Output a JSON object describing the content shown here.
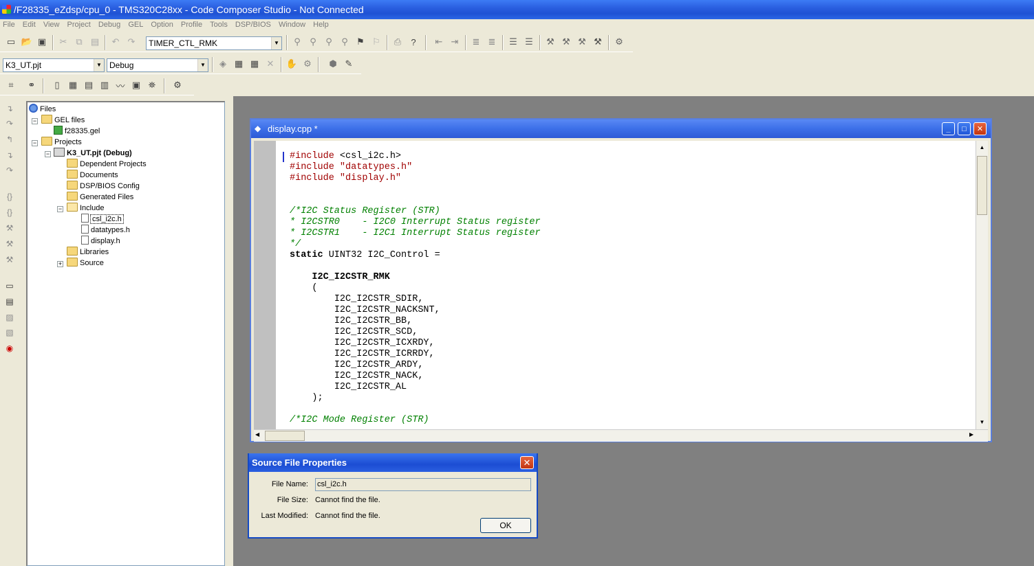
{
  "window": {
    "title": "/F28335_eZdsp/cpu_0 - TMS320C28xx - Code Composer Studio - Not Connected"
  },
  "menu": [
    "File",
    "Edit",
    "View",
    "Project",
    "Debug",
    "GEL",
    "Option",
    "Profile",
    "Tools",
    "DSP/BIOS",
    "Window",
    "Help"
  ],
  "toolbar": {
    "symbol_combo": "TIMER_CTL_RMK",
    "project_combo": "K3_UT.pjt",
    "config_combo": "Debug"
  },
  "tree": {
    "root": "Files",
    "gel_files": "GEL files",
    "gel_file": "f28335.gel",
    "projects": "Projects",
    "project": "K3_UT.pjt (Debug)",
    "dependent": "Dependent Projects",
    "documents": "Documents",
    "dspbios": "DSP/BIOS Config",
    "generated": "Generated Files",
    "include": "Include",
    "inc_file_1": "csl_i2c.h",
    "inc_file_2": "datatypes.h",
    "inc_file_3": "display.h",
    "libraries": "Libraries",
    "source": "Source",
    "collapse_sign": "−",
    "expand_sign": "+"
  },
  "editor": {
    "title": "display.cpp *",
    "lines": {
      "l1a": "#include ",
      "l1b": "<csl_i2c.h>",
      "l2a": "#include ",
      "l2b": "\"datatypes.h\"",
      "l3a": "#include ",
      "l3b": "\"display.h\"",
      "c1": "/*I2C Status Register (STR)",
      "c2": "* I2CSTR0    - I2C0 Interrupt Status register",
      "c3": "* I2CSTR1    - I2C1 Interrupt Status register",
      "c4": "*/",
      "s1a": "static",
      "s1b": " UINT32 I2C_Control =",
      "m1": "I2C_I2CSTR_RMK",
      "p1": "(",
      "a1": "I2C_I2CSTR_SDIR,",
      "a2": "I2C_I2CSTR_NACKSNT,",
      "a3": "I2C_I2CSTR_BB,",
      "a4": "I2C_I2CSTR_SCD,",
      "a5": "I2C_I2CSTR_ICXRDY,",
      "a6": "I2C_I2CSTR_ICRRDY,",
      "a7": "I2C_I2CSTR_ARDY,",
      "a8": "I2C_I2CSTR_NACK,",
      "a9": "I2C_I2CSTR_AL",
      "p2": ");",
      "c5": "/*I2C Mode Register (STR)"
    }
  },
  "dialog": {
    "title": "Source File Properties",
    "file_name_label": "File Name:",
    "file_name_value": "csl_i2c.h",
    "file_size_label": "File Size:",
    "file_size_value": "Cannot find the file.",
    "last_modified_label": "Last Modified:",
    "last_modified_value": "Cannot find the file.",
    "ok": "OK"
  }
}
